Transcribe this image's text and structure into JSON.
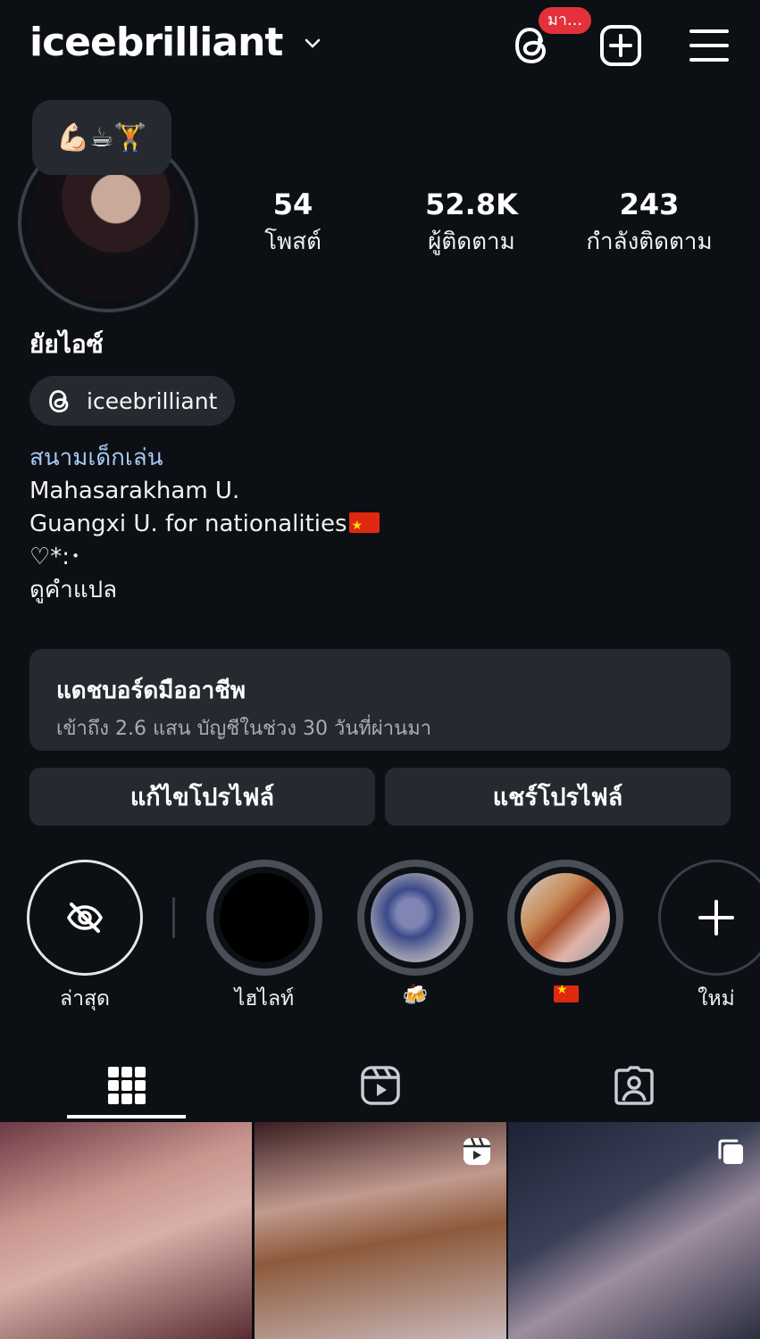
{
  "header": {
    "username": "iceebrilliant",
    "threads_badge": "มา..."
  },
  "note": {
    "emojis": "💪🏻☕🏋️"
  },
  "stats": {
    "posts": {
      "value": "54",
      "label": "โพสต์"
    },
    "followers": {
      "value": "52.8K",
      "label": "ผู้ติดตาม"
    },
    "following": {
      "value": "243",
      "label": "กำลังติดตาม"
    }
  },
  "profile": {
    "display_name": "ยัยไอซ์",
    "threads_handle": "iceebrilliant"
  },
  "bio": {
    "category": "สนามเด็กเล่น",
    "line1": "Mahasarakham U.",
    "line2": "Guangxi U. for nationalities",
    "line3": "♡*:･",
    "translate": "ดูคำแปล"
  },
  "dashboard": {
    "title": "แดชบอร์ดมืออาชีพ",
    "subtitle": "เข้าถึง 2.6 แสน บัญชีในช่วง 30 วันที่ผ่านมา"
  },
  "buttons": {
    "edit_profile": "แก้ไขโปรไฟล์",
    "share_profile": "แชร์โปรไฟล์"
  },
  "highlights": [
    {
      "label": "ล่าสุด"
    },
    {
      "label": "ไฮไลท์"
    },
    {
      "label": "🍻"
    },
    {
      "label": ""
    },
    {
      "label": "ใหม่"
    }
  ],
  "colors": {
    "background": "#0c0f14",
    "surface": "#262a30",
    "link": "#a8c7f5",
    "badge": "#e3313b"
  },
  "icons": {
    "threads": "threads-icon",
    "new_post": "plus-square-icon",
    "menu": "hamburger-menu-icon",
    "hidden": "eye-off-icon",
    "grid": "grid-icon",
    "reels": "reels-icon",
    "tagged": "tagged-person-icon",
    "multi": "carousel-icon"
  }
}
